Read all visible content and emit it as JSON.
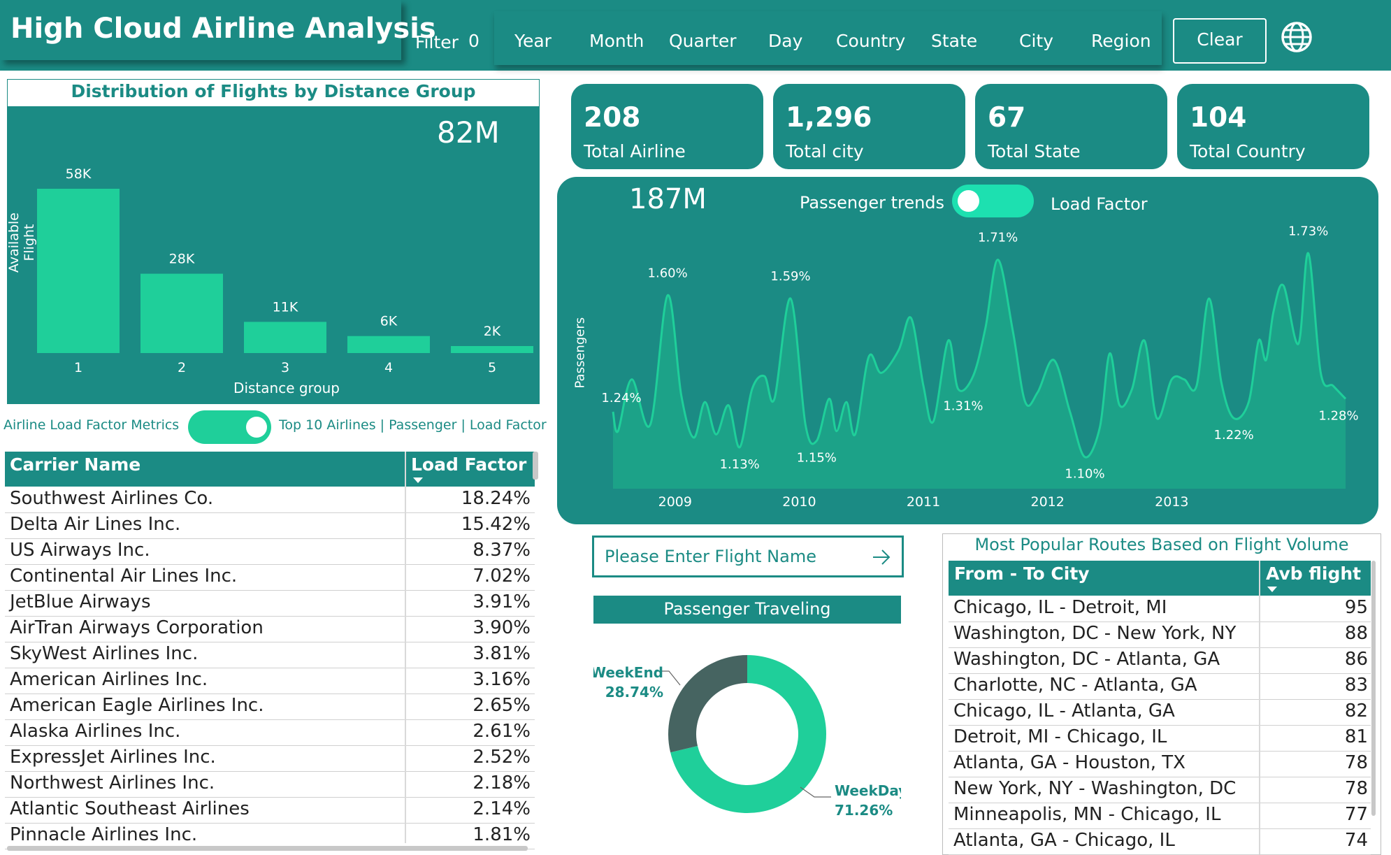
{
  "header": {
    "title": "High Cloud Airline Analysis",
    "filter_label": "Filter",
    "filter_count": "0",
    "nav": [
      "Year",
      "Month",
      "Quarter",
      "Day",
      "Country",
      "State",
      "City",
      "Region"
    ],
    "clear_filter": "Clear Filter",
    "globe_icon": "globe-icon"
  },
  "distance_panel": {
    "title": "Distribution of Flights by Distance Group",
    "total": "82M"
  },
  "toggle_row": {
    "left_label": "Airline Load Factor Metrics",
    "right_label": "Top 10 Airlines | Passenger | Load Factor"
  },
  "carrier_table": {
    "col1": "Carrier Name",
    "col2": "Load Factor",
    "rows": [
      {
        "name": "Southwest Airlines Co.",
        "value": "18.24%"
      },
      {
        "name": "Delta Air Lines Inc.",
        "value": "15.42%"
      },
      {
        "name": "US Airways Inc.",
        "value": "8.37%"
      },
      {
        "name": "Continental Air Lines Inc.",
        "value": "7.02%"
      },
      {
        "name": "JetBlue Airways",
        "value": "3.91%"
      },
      {
        "name": "AirTran Airways Corporation",
        "value": "3.90%"
      },
      {
        "name": "SkyWest Airlines Inc.",
        "value": "3.81%"
      },
      {
        "name": "American Airlines Inc.",
        "value": "3.16%"
      },
      {
        "name": "American Eagle Airlines Inc.",
        "value": "2.65%"
      },
      {
        "name": "Alaska Airlines Inc.",
        "value": "2.61%"
      },
      {
        "name": "ExpressJet Airlines Inc.",
        "value": "2.52%"
      },
      {
        "name": "Northwest Airlines Inc.",
        "value": "2.18%"
      },
      {
        "name": "Atlantic Southeast Airlines",
        "value": "2.14%"
      },
      {
        "name": "Pinnacle Airlines Inc.",
        "value": "1.81%"
      }
    ]
  },
  "kpis": [
    {
      "value": "208",
      "label": "Total Airline"
    },
    {
      "value": "1,296",
      "label": "Total city"
    },
    {
      "value": "67",
      "label": "Total State"
    },
    {
      "value": "104",
      "label": "Total Country"
    }
  ],
  "trend_panel": {
    "total": "187M",
    "label": "Passenger trends",
    "toggle_label": "Load Factor"
  },
  "search": {
    "placeholder": "Please Enter Flight Name",
    "arrow_icon": "arrow-right-icon"
  },
  "passenger_traveling": {
    "title": "Passenger Traveling"
  },
  "routes": {
    "title": "Most Popular Routes Based on Flight Volume",
    "col1": "From - To City",
    "col2": "Avb flight",
    "rows": [
      {
        "route": "Chicago, IL - Detroit, MI",
        "value": "95"
      },
      {
        "route": "Washington, DC - New York, NY",
        "value": "88"
      },
      {
        "route": "Washington, DC - Atlanta, GA",
        "value": "86"
      },
      {
        "route": "Charlotte, NC - Atlanta, GA",
        "value": "83"
      },
      {
        "route": "Chicago, IL - Atlanta, GA",
        "value": "82"
      },
      {
        "route": "Detroit, MI - Chicago, IL",
        "value": "81"
      },
      {
        "route": "Atlanta, GA - Houston, TX",
        "value": "78"
      },
      {
        "route": "New York, NY - Washington, DC",
        "value": "78"
      },
      {
        "route": "Minneapolis, MN - Chicago, IL",
        "value": "77"
      },
      {
        "route": "Atlanta, GA - Chicago, IL",
        "value": "74"
      }
    ]
  },
  "colors": {
    "teal": "#1b8b84",
    "mint": "#1fcf9a",
    "dark_slate": "#466461"
  },
  "chart_data": [
    {
      "type": "bar",
      "title": "Distribution of Flights by Distance Group",
      "xlabel": "Distance group",
      "ylabel": "Available Flight",
      "categories": [
        "1",
        "2",
        "3",
        "4",
        "5"
      ],
      "values": [
        58000,
        28000,
        11000,
        6000,
        2000
      ],
      "data_labels": [
        "58K",
        "28K",
        "11K",
        "6K",
        "2K"
      ]
    },
    {
      "type": "area",
      "ylabel": "Passengers",
      "x_ticks": [
        "2009",
        "2010",
        "2011",
        "2012",
        "2013"
      ],
      "x_range": [
        2008.5,
        2014.4
      ],
      "ylim": [
        1.0,
        1.75
      ],
      "points": [
        [
          2008.5,
          1.24
        ],
        [
          2008.54,
          1.18
        ],
        [
          2008.65,
          1.34
        ],
        [
          2008.8,
          1.2
        ],
        [
          2008.94,
          1.6
        ],
        [
          2009.05,
          1.29
        ],
        [
          2009.15,
          1.16
        ],
        [
          2009.24,
          1.27
        ],
        [
          2009.33,
          1.17
        ],
        [
          2009.43,
          1.26
        ],
        [
          2009.52,
          1.13
        ],
        [
          2009.62,
          1.31
        ],
        [
          2009.72,
          1.35
        ],
        [
          2009.8,
          1.28
        ],
        [
          2009.93,
          1.59
        ],
        [
          2010.05,
          1.2
        ],
        [
          2010.14,
          1.15
        ],
        [
          2010.24,
          1.28
        ],
        [
          2010.3,
          1.18
        ],
        [
          2010.38,
          1.27
        ],
        [
          2010.45,
          1.17
        ],
        [
          2010.56,
          1.41
        ],
        [
          2010.66,
          1.36
        ],
        [
          2010.8,
          1.43
        ],
        [
          2010.9,
          1.53
        ],
        [
          2011.0,
          1.32
        ],
        [
          2011.08,
          1.21
        ],
        [
          2011.2,
          1.46
        ],
        [
          2011.28,
          1.31
        ],
        [
          2011.4,
          1.35
        ],
        [
          2011.5,
          1.5
        ],
        [
          2011.6,
          1.71
        ],
        [
          2011.72,
          1.49
        ],
        [
          2011.82,
          1.27
        ],
        [
          2011.92,
          1.3
        ],
        [
          2012.05,
          1.4
        ],
        [
          2012.18,
          1.24
        ],
        [
          2012.3,
          1.1
        ],
        [
          2012.42,
          1.19
        ],
        [
          2012.5,
          1.42
        ],
        [
          2012.58,
          1.26
        ],
        [
          2012.68,
          1.31
        ],
        [
          2012.78,
          1.46
        ],
        [
          2012.88,
          1.22
        ],
        [
          2013.0,
          1.34
        ],
        [
          2013.1,
          1.34
        ],
        [
          2013.2,
          1.32
        ],
        [
          2013.3,
          1.59
        ],
        [
          2013.4,
          1.33
        ],
        [
          2013.5,
          1.22
        ],
        [
          2013.62,
          1.27
        ],
        [
          2013.7,
          1.46
        ],
        [
          2013.76,
          1.4
        ],
        [
          2013.82,
          1.55
        ],
        [
          2013.9,
          1.63
        ],
        [
          2014.02,
          1.45
        ],
        [
          2014.1,
          1.73
        ],
        [
          2014.2,
          1.36
        ],
        [
          2014.3,
          1.32
        ],
        [
          2014.4,
          1.28
        ]
      ],
      "labels": [
        {
          "x": 2008.5,
          "text": "1.24%"
        },
        {
          "x": 2008.94,
          "text": "1.60%"
        },
        {
          "x": 2009.52,
          "text": "1.13%"
        },
        {
          "x": 2009.93,
          "text": "1.59%"
        },
        {
          "x": 2010.14,
          "text": "1.15%"
        },
        {
          "x": 2011.6,
          "text": "1.71%"
        },
        {
          "x": 2011.32,
          "text": "1.31%"
        },
        {
          "x": 2012.3,
          "text": "1.10%"
        },
        {
          "x": 2013.5,
          "text": "1.22%"
        },
        {
          "x": 2014.1,
          "text": "1.73%"
        },
        {
          "x": 2014.4,
          "text": "1.28%"
        }
      ]
    },
    {
      "type": "pie",
      "title": "Passenger Traveling",
      "slices": [
        {
          "name": "WeekDay",
          "value": 71.26,
          "label": "71.26%",
          "color": "#1fcf9a"
        },
        {
          "name": "WeekEnd",
          "value": 28.74,
          "label": "28.74%",
          "color": "#466461"
        }
      ]
    }
  ]
}
